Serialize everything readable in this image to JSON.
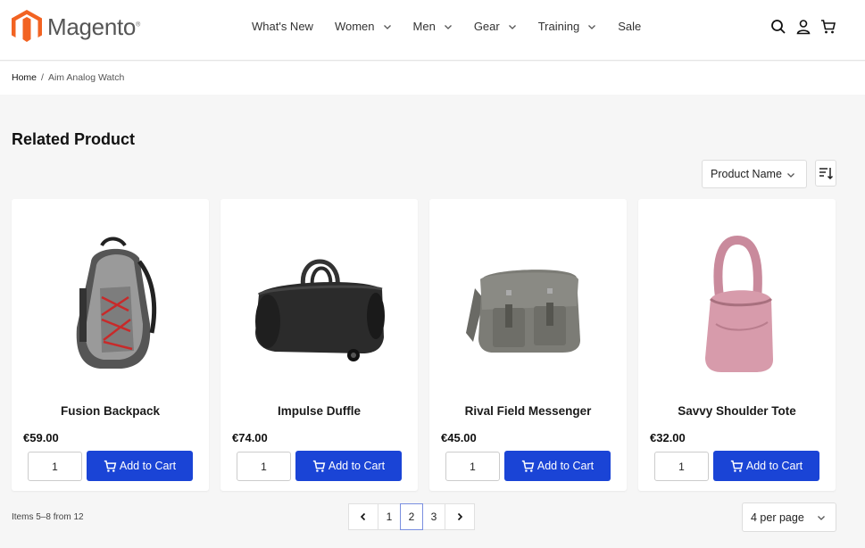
{
  "header": {
    "logo_text": "Magento",
    "logo_mark": "®",
    "nav": [
      {
        "label": "What's New",
        "has_dropdown": false
      },
      {
        "label": "Women",
        "has_dropdown": true
      },
      {
        "label": "Men",
        "has_dropdown": true
      },
      {
        "label": "Gear",
        "has_dropdown": true
      },
      {
        "label": "Training",
        "has_dropdown": true
      },
      {
        "label": "Sale",
        "has_dropdown": false
      }
    ],
    "icons": [
      "search-icon",
      "account-icon",
      "cart-icon"
    ]
  },
  "breadcrumb": {
    "home": "Home",
    "separator": "/",
    "current": "Aim Analog Watch"
  },
  "section_title": "Related Product",
  "sort": {
    "selected": "Product Name",
    "direction_icon": "sort-descending-icon"
  },
  "products": [
    {
      "name": "Fusion Backpack",
      "price": "€59.00",
      "qty": "1",
      "button": "Add to Cart",
      "image": "backpack"
    },
    {
      "name": "Impulse Duffle",
      "price": "€74.00",
      "qty": "1",
      "button": "Add to Cart",
      "image": "duffle"
    },
    {
      "name": "Rival Field Messenger",
      "price": "€45.00",
      "qty": "1",
      "button": "Add to Cart",
      "image": "messenger"
    },
    {
      "name": "Savvy Shoulder Tote",
      "price": "€32.00",
      "qty": "1",
      "button": "Add to Cart",
      "image": "tote"
    }
  ],
  "footer": {
    "items_count": "Items 5–8 from 12",
    "pages": [
      "1",
      "2",
      "3"
    ],
    "current_page": "2",
    "per_page": "4 per page"
  },
  "colors": {
    "accent": "#1a44d6",
    "logo_orange": "#f26322"
  }
}
